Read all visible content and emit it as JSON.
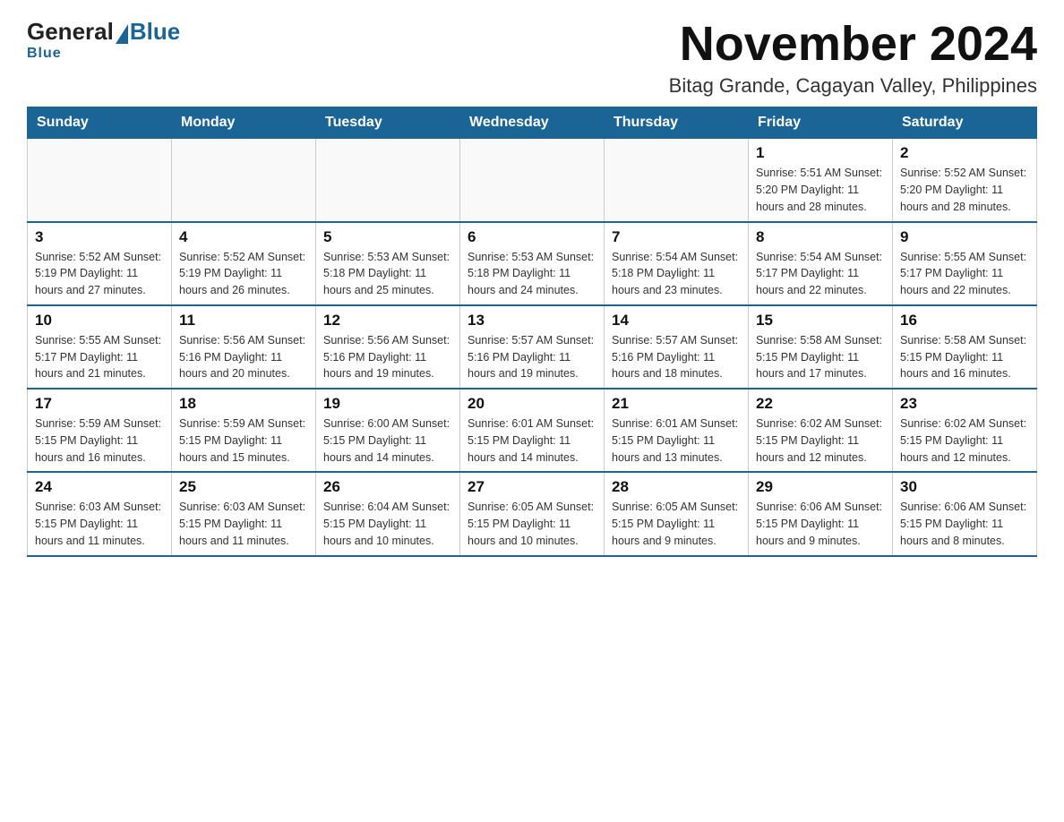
{
  "header": {
    "logo_general": "General",
    "logo_blue": "Blue",
    "month_title": "November 2024",
    "location": "Bitag Grande, Cagayan Valley, Philippines"
  },
  "days_of_week": [
    "Sunday",
    "Monday",
    "Tuesday",
    "Wednesday",
    "Thursday",
    "Friday",
    "Saturday"
  ],
  "weeks": [
    [
      {
        "day": "",
        "info": ""
      },
      {
        "day": "",
        "info": ""
      },
      {
        "day": "",
        "info": ""
      },
      {
        "day": "",
        "info": ""
      },
      {
        "day": "",
        "info": ""
      },
      {
        "day": "1",
        "info": "Sunrise: 5:51 AM\nSunset: 5:20 PM\nDaylight: 11 hours and 28 minutes."
      },
      {
        "day": "2",
        "info": "Sunrise: 5:52 AM\nSunset: 5:20 PM\nDaylight: 11 hours and 28 minutes."
      }
    ],
    [
      {
        "day": "3",
        "info": "Sunrise: 5:52 AM\nSunset: 5:19 PM\nDaylight: 11 hours and 27 minutes."
      },
      {
        "day": "4",
        "info": "Sunrise: 5:52 AM\nSunset: 5:19 PM\nDaylight: 11 hours and 26 minutes."
      },
      {
        "day": "5",
        "info": "Sunrise: 5:53 AM\nSunset: 5:18 PM\nDaylight: 11 hours and 25 minutes."
      },
      {
        "day": "6",
        "info": "Sunrise: 5:53 AM\nSunset: 5:18 PM\nDaylight: 11 hours and 24 minutes."
      },
      {
        "day": "7",
        "info": "Sunrise: 5:54 AM\nSunset: 5:18 PM\nDaylight: 11 hours and 23 minutes."
      },
      {
        "day": "8",
        "info": "Sunrise: 5:54 AM\nSunset: 5:17 PM\nDaylight: 11 hours and 22 minutes."
      },
      {
        "day": "9",
        "info": "Sunrise: 5:55 AM\nSunset: 5:17 PM\nDaylight: 11 hours and 22 minutes."
      }
    ],
    [
      {
        "day": "10",
        "info": "Sunrise: 5:55 AM\nSunset: 5:17 PM\nDaylight: 11 hours and 21 minutes."
      },
      {
        "day": "11",
        "info": "Sunrise: 5:56 AM\nSunset: 5:16 PM\nDaylight: 11 hours and 20 minutes."
      },
      {
        "day": "12",
        "info": "Sunrise: 5:56 AM\nSunset: 5:16 PM\nDaylight: 11 hours and 19 minutes."
      },
      {
        "day": "13",
        "info": "Sunrise: 5:57 AM\nSunset: 5:16 PM\nDaylight: 11 hours and 19 minutes."
      },
      {
        "day": "14",
        "info": "Sunrise: 5:57 AM\nSunset: 5:16 PM\nDaylight: 11 hours and 18 minutes."
      },
      {
        "day": "15",
        "info": "Sunrise: 5:58 AM\nSunset: 5:15 PM\nDaylight: 11 hours and 17 minutes."
      },
      {
        "day": "16",
        "info": "Sunrise: 5:58 AM\nSunset: 5:15 PM\nDaylight: 11 hours and 16 minutes."
      }
    ],
    [
      {
        "day": "17",
        "info": "Sunrise: 5:59 AM\nSunset: 5:15 PM\nDaylight: 11 hours and 16 minutes."
      },
      {
        "day": "18",
        "info": "Sunrise: 5:59 AM\nSunset: 5:15 PM\nDaylight: 11 hours and 15 minutes."
      },
      {
        "day": "19",
        "info": "Sunrise: 6:00 AM\nSunset: 5:15 PM\nDaylight: 11 hours and 14 minutes."
      },
      {
        "day": "20",
        "info": "Sunrise: 6:01 AM\nSunset: 5:15 PM\nDaylight: 11 hours and 14 minutes."
      },
      {
        "day": "21",
        "info": "Sunrise: 6:01 AM\nSunset: 5:15 PM\nDaylight: 11 hours and 13 minutes."
      },
      {
        "day": "22",
        "info": "Sunrise: 6:02 AM\nSunset: 5:15 PM\nDaylight: 11 hours and 12 minutes."
      },
      {
        "day": "23",
        "info": "Sunrise: 6:02 AM\nSunset: 5:15 PM\nDaylight: 11 hours and 12 minutes."
      }
    ],
    [
      {
        "day": "24",
        "info": "Sunrise: 6:03 AM\nSunset: 5:15 PM\nDaylight: 11 hours and 11 minutes."
      },
      {
        "day": "25",
        "info": "Sunrise: 6:03 AM\nSunset: 5:15 PM\nDaylight: 11 hours and 11 minutes."
      },
      {
        "day": "26",
        "info": "Sunrise: 6:04 AM\nSunset: 5:15 PM\nDaylight: 11 hours and 10 minutes."
      },
      {
        "day": "27",
        "info": "Sunrise: 6:05 AM\nSunset: 5:15 PM\nDaylight: 11 hours and 10 minutes."
      },
      {
        "day": "28",
        "info": "Sunrise: 6:05 AM\nSunset: 5:15 PM\nDaylight: 11 hours and 9 minutes."
      },
      {
        "day": "29",
        "info": "Sunrise: 6:06 AM\nSunset: 5:15 PM\nDaylight: 11 hours and 9 minutes."
      },
      {
        "day": "30",
        "info": "Sunrise: 6:06 AM\nSunset: 5:15 PM\nDaylight: 11 hours and 8 minutes."
      }
    ]
  ]
}
